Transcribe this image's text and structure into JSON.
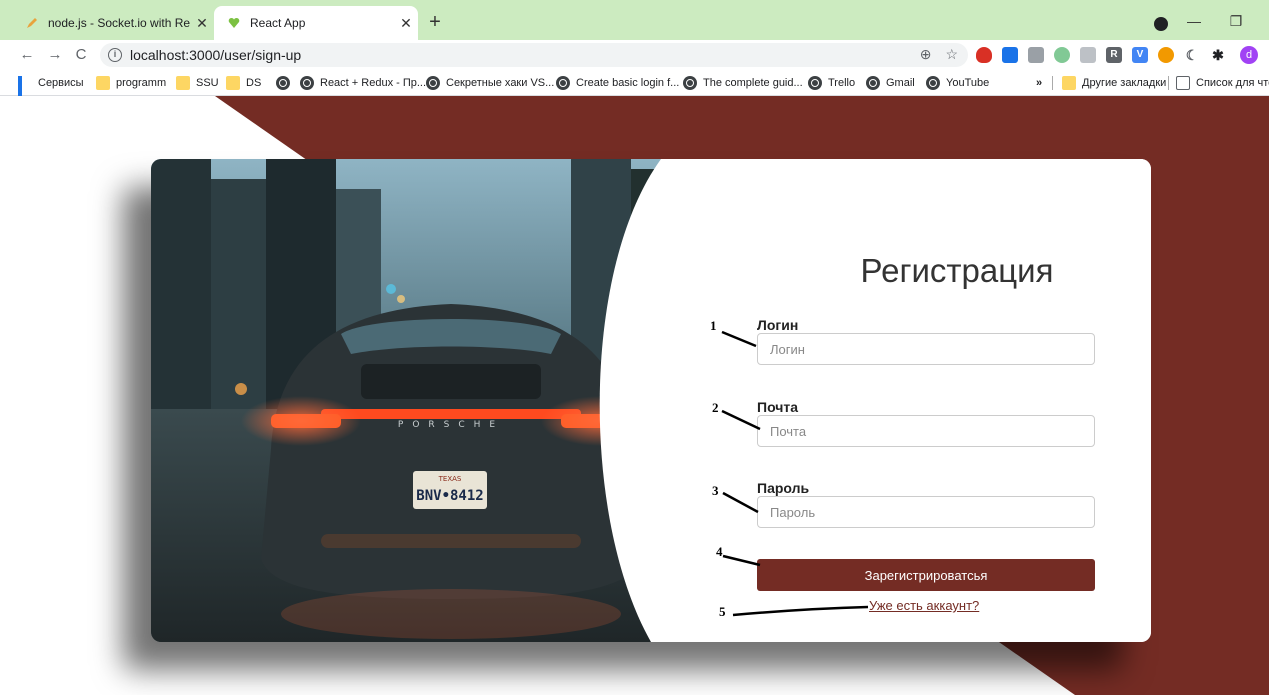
{
  "browser": {
    "tabs": [
      {
        "title": "node.js - Socket.io with React be",
        "favicon": "pencil-icon",
        "active": false
      },
      {
        "title": "React App",
        "favicon": "heart-icon",
        "active": true
      }
    ],
    "new_tab": "+",
    "address": "localhost:3000/user/sign-up",
    "bookmarks": [
      {
        "label": "Сервисы",
        "icon": "apps-icon"
      },
      {
        "label": "programm",
        "icon": "folder-icon"
      },
      {
        "label": "SSU",
        "icon": "folder-icon"
      },
      {
        "label": "DS",
        "icon": "folder-icon"
      },
      {
        "label": "",
        "icon": "globe-icon"
      },
      {
        "label": "React + Redux - Пр...",
        "icon": "globe-icon"
      },
      {
        "label": "Секретные хаки VS...",
        "icon": "globe-icon"
      },
      {
        "label": "Create basic login f...",
        "icon": "globe-icon"
      },
      {
        "label": "The complete guid...",
        "icon": "globe-icon"
      },
      {
        "label": "Trello",
        "icon": "globe-icon"
      },
      {
        "label": "Gmail",
        "icon": "globe-icon"
      },
      {
        "label": "YouTube",
        "icon": "globe-icon"
      }
    ],
    "bookmarks_overflow": "»",
    "other_bookmarks": "Другие закладки",
    "reading_list": "Список для чтен",
    "profile_initial": "d"
  },
  "colors": {
    "accent": "#742c24",
    "tab_strip": "#ccebc0"
  },
  "form": {
    "title": "Регистрация",
    "login_label": "Логин",
    "login_placeholder": "Логин",
    "email_label": "Почта",
    "email_placeholder": "Почта",
    "password_label": "Пароль",
    "password_placeholder": "Пароль",
    "submit_label": "Зарегистрироватсья",
    "signin_link": "Уже есть аккаунт?"
  },
  "photo": {
    "plate_top": "TEXAS",
    "plate_number": "BNV•8412",
    "brand_lettering": "PORSCHE"
  },
  "annotations": [
    "1",
    "2",
    "3",
    "4",
    "5"
  ]
}
